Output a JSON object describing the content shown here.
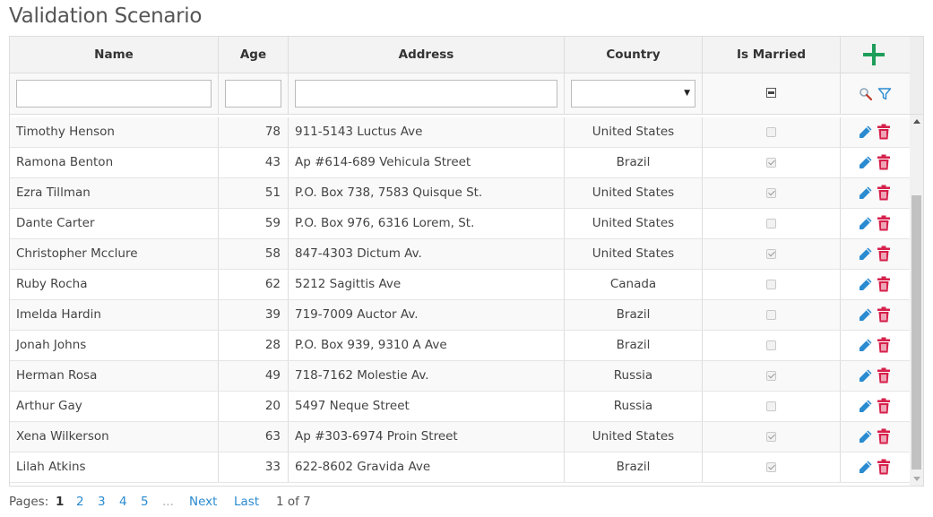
{
  "page": {
    "title": "Validation Scenario"
  },
  "columns": {
    "name": "Name",
    "age": "Age",
    "address": "Address",
    "country": "Country",
    "married": "Is Married"
  },
  "filters": {
    "name": "",
    "age": "",
    "address": "",
    "country": "",
    "married_state": "indeterminate"
  },
  "rows": [
    {
      "name": "Timothy Henson",
      "age": "78",
      "address": "911-5143 Luctus Ave",
      "country": "United States",
      "married": false
    },
    {
      "name": "Ramona Benton",
      "age": "43",
      "address": "Ap #614-689 Vehicula Street",
      "country": "Brazil",
      "married": true
    },
    {
      "name": "Ezra Tillman",
      "age": "51",
      "address": "P.O. Box 738, 7583 Quisque St.",
      "country": "United States",
      "married": true
    },
    {
      "name": "Dante Carter",
      "age": "59",
      "address": "P.O. Box 976, 6316 Lorem, St.",
      "country": "United States",
      "married": false
    },
    {
      "name": "Christopher Mcclure",
      "age": "58",
      "address": "847-4303 Dictum Av.",
      "country": "United States",
      "married": true
    },
    {
      "name": "Ruby Rocha",
      "age": "62",
      "address": "5212 Sagittis Ave",
      "country": "Canada",
      "married": false
    },
    {
      "name": "Imelda Hardin",
      "age": "39",
      "address": "719-7009 Auctor Av.",
      "country": "Brazil",
      "married": false
    },
    {
      "name": "Jonah Johns",
      "age": "28",
      "address": "P.O. Box 939, 9310 A Ave",
      "country": "Brazil",
      "married": false
    },
    {
      "name": "Herman Rosa",
      "age": "49",
      "address": "718-7162 Molestie Av.",
      "country": "Russia",
      "married": true
    },
    {
      "name": "Arthur Gay",
      "age": "20",
      "address": "5497 Neque Street",
      "country": "Russia",
      "married": false
    },
    {
      "name": "Xena Wilkerson",
      "age": "63",
      "address": "Ap #303-6974 Proin Street",
      "country": "United States",
      "married": true
    },
    {
      "name": "Lilah Atkins",
      "age": "33",
      "address": "622-8602 Gravida Ave",
      "country": "Brazil",
      "married": true
    }
  ],
  "pager": {
    "label": "Pages:",
    "current": "1",
    "pages": [
      "2",
      "3",
      "4",
      "5"
    ],
    "ellipsis": "...",
    "next": "Next",
    "last": "Last",
    "summary": "1 of 7"
  },
  "icons": {
    "add": "plus-icon",
    "search": "search-icon",
    "filter": "filter-icon",
    "edit": "pencil-icon",
    "delete": "trash-icon"
  },
  "colors": {
    "add": "#1e9e5a",
    "edit": "#2a8bd0",
    "delete": "#d6204b",
    "link": "#2a8bd0"
  }
}
